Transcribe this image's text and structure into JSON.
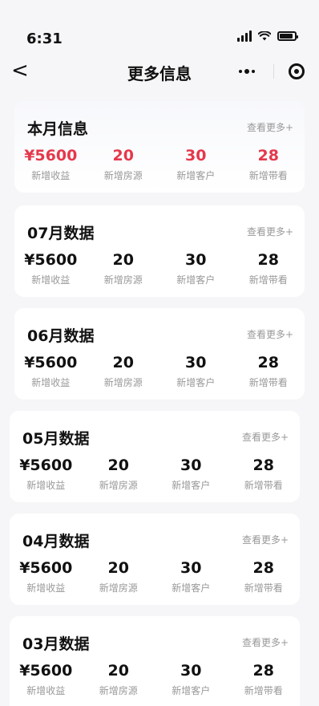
{
  "status": {
    "time": "6:31"
  },
  "nav": {
    "title": "更多信息",
    "back_glyph": "<"
  },
  "current": {
    "title": "本月信息",
    "more": "查看更多+",
    "stats": [
      {
        "value": "¥5600",
        "label": "新增收益"
      },
      {
        "value": "20",
        "label": "新增房源"
      },
      {
        "value": "30",
        "label": "新增客户"
      },
      {
        "value": "28",
        "label": "新增带看"
      }
    ]
  },
  "months": [
    {
      "title": "07月数据",
      "more": "查看更多+",
      "stats": [
        {
          "value": "¥5600",
          "label": "新增收益"
        },
        {
          "value": "20",
          "label": "新增房源"
        },
        {
          "value": "30",
          "label": "新增客户"
        },
        {
          "value": "28",
          "label": "新增带看"
        }
      ]
    },
    {
      "title": "06月数据",
      "more": "查看更多+",
      "stats": [
        {
          "value": "¥5600",
          "label": "新增收益"
        },
        {
          "value": "20",
          "label": "新增房源"
        },
        {
          "value": "30",
          "label": "新增客户"
        },
        {
          "value": "28",
          "label": "新增带看"
        }
      ]
    },
    {
      "title": "05月数据",
      "more": "查看更多+",
      "stats": [
        {
          "value": "¥5600",
          "label": "新增收益"
        },
        {
          "value": "20",
          "label": "新增房源"
        },
        {
          "value": "30",
          "label": "新增客户"
        },
        {
          "value": "28",
          "label": "新增带看"
        }
      ]
    },
    {
      "title": "04月数据",
      "more": "查看更多+",
      "stats": [
        {
          "value": "¥5600",
          "label": "新增收益"
        },
        {
          "value": "20",
          "label": "新增房源"
        },
        {
          "value": "30",
          "label": "新增客户"
        },
        {
          "value": "28",
          "label": "新增带看"
        }
      ]
    },
    {
      "title": "03月数据",
      "more": "查看更多+",
      "stats": [
        {
          "value": "¥5600",
          "label": "新增收益"
        },
        {
          "value": "20",
          "label": "新增房源"
        },
        {
          "value": "30",
          "label": "新增客户"
        },
        {
          "value": "28",
          "label": "新增带看"
        }
      ]
    }
  ],
  "colors": {
    "accent": "#e5384b",
    "muted": "#999999"
  },
  "icons": [
    "back-arrow-icon",
    "more-dots-icon",
    "target-icon",
    "signal-icon",
    "wifi-icon",
    "battery-icon"
  ]
}
